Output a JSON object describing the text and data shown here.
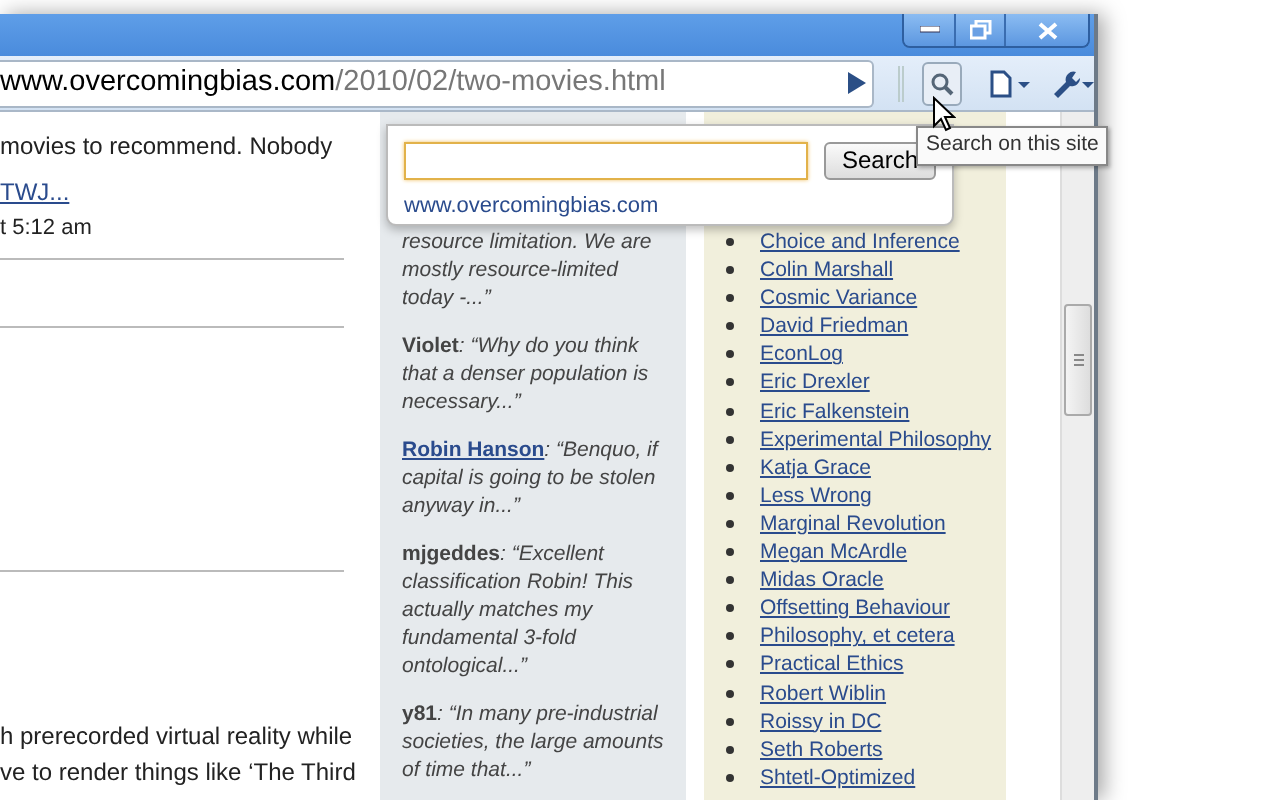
{
  "address_bar": {
    "host": "www.overcomingbias.com",
    "path": "/2010/02/two-movies.html"
  },
  "search_popup": {
    "button": "Search",
    "site": "www.overcomingbias.com"
  },
  "tooltip": "Search on this site",
  "left_column": [
    {
      "kind": "text",
      "text": "movies to recommend. Nobody"
    },
    {
      "kind": "link",
      "text": "TWJ..."
    },
    {
      "kind": "meta",
      "text": "t 5:12 am"
    },
    {
      "kind": "rule"
    },
    {
      "kind": "rule"
    },
    {
      "kind": "rule"
    },
    {
      "kind": "text",
      "text": "h prerecorded virtual reality while"
    },
    {
      "kind": "text",
      "text": "ve to render things like ‘The Third"
    }
  ],
  "comments": [
    {
      "text": "resource limitation. We are mostly resource-limited today -...”"
    },
    {
      "author": "Violet",
      "author_link": false,
      "text": ": “Why do you think that a denser population is necessary...”"
    },
    {
      "author": "Robin Hanson",
      "author_link": true,
      "text": ": “Benquo, if capital is going to be stolen anyway in...”"
    },
    {
      "author": "mjgeddes",
      "author_link": false,
      "text": ": “Excellent classification Robin! This actually matches my fundamental 3-fold ontological...”"
    },
    {
      "author": "y81",
      "author_link": false,
      "text": ": “In many pre-industrial societies, the large amounts of time that...”"
    }
  ],
  "blogroll": [
    "Choice and Inference",
    "Colin Marshall",
    "Cosmic Variance",
    "David Friedman",
    "EconLog",
    "Eric Drexler",
    "Eric Falkenstein",
    "Experimental Philosophy",
    "Katja Grace",
    "Less Wrong",
    "Marginal Revolution",
    "Megan McArdle",
    "Midas Oracle",
    "Offsetting Behaviour",
    "Philosophy, et cetera",
    "Practical Ethics",
    "Robert Wiblin",
    "Roissy in DC",
    "Seth Roberts",
    "Shtetl-Optimized"
  ]
}
